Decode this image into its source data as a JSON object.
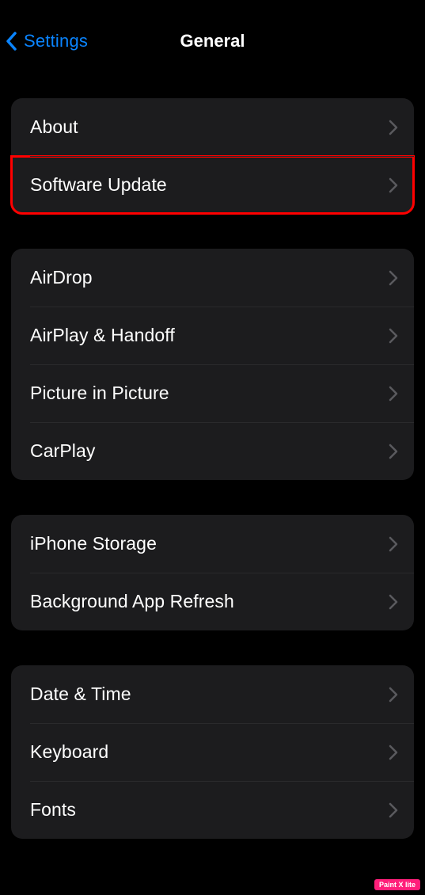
{
  "nav": {
    "back_label": "Settings",
    "title": "General"
  },
  "groups": {
    "g1": {
      "items": [
        {
          "label": "About"
        },
        {
          "label": "Software Update"
        }
      ]
    },
    "g2": {
      "items": [
        {
          "label": "AirDrop"
        },
        {
          "label": "AirPlay & Handoff"
        },
        {
          "label": "Picture in Picture"
        },
        {
          "label": "CarPlay"
        }
      ]
    },
    "g3": {
      "items": [
        {
          "label": "iPhone Storage"
        },
        {
          "label": "Background App Refresh"
        }
      ]
    },
    "g4": {
      "items": [
        {
          "label": "Date & Time"
        },
        {
          "label": "Keyboard"
        },
        {
          "label": "Fonts"
        }
      ]
    }
  },
  "watermark": "Paint X lite"
}
